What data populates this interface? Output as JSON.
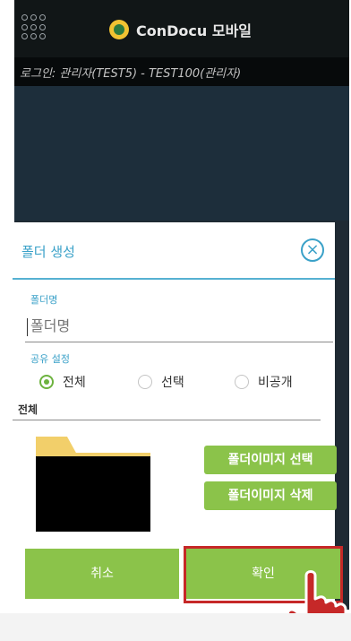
{
  "app": {
    "brand": "ConDocu 모바일"
  },
  "userbar": {
    "text": "로그인: 관리자(TEST5) - TEST100(관리자)"
  },
  "dialog": {
    "title": "폴더 생성",
    "close_icon": "close-circle-icon",
    "folder_name": {
      "label": "폴더명",
      "value": "",
      "placeholder": "폴더명"
    },
    "share": {
      "label": "공유 설정",
      "options": [
        {
          "label": "전체",
          "selected": true
        },
        {
          "label": "선택",
          "selected": false
        },
        {
          "label": "비공개",
          "selected": false
        }
      ],
      "value": "전체"
    },
    "image_buttons": {
      "select": "폴더이미지 선택",
      "delete": "폴더이미지 삭제"
    },
    "actions": {
      "cancel": "취소",
      "confirm": "확인"
    }
  },
  "colors": {
    "accent": "#3aa1c8",
    "green": "#8bc34a",
    "highlight": "#c62828",
    "hand": "#c62828"
  }
}
